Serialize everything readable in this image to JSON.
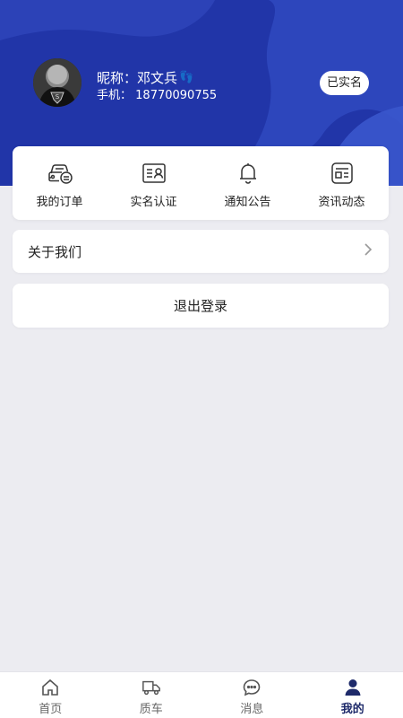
{
  "profile": {
    "nickname_label": "昵称：",
    "nickname": "邓文兵",
    "nickname_emoji": "👣",
    "phone_label": "手机：",
    "phone": "18770090755",
    "verified_badge": "已实名"
  },
  "quick_links": [
    {
      "label": "我的订单",
      "icon": "car-order-icon"
    },
    {
      "label": "实名认证",
      "icon": "id-card-icon"
    },
    {
      "label": "通知公告",
      "icon": "bell-icon"
    },
    {
      "label": "资讯动态",
      "icon": "news-icon"
    }
  ],
  "about": {
    "label": "关于我们"
  },
  "logout": {
    "label": "退出登录"
  },
  "tabbar": {
    "tabs": [
      {
        "label": "首页",
        "icon": "home-icon"
      },
      {
        "label": "质车",
        "icon": "truck-icon"
      },
      {
        "label": "消息",
        "icon": "chat-icon"
      },
      {
        "label": "我的",
        "icon": "person-icon"
      }
    ],
    "active_index": 3
  },
  "colors": {
    "header_bg": "#2135a8",
    "page_bg": "#ececf1",
    "active_tab": "#1e2a6a"
  }
}
